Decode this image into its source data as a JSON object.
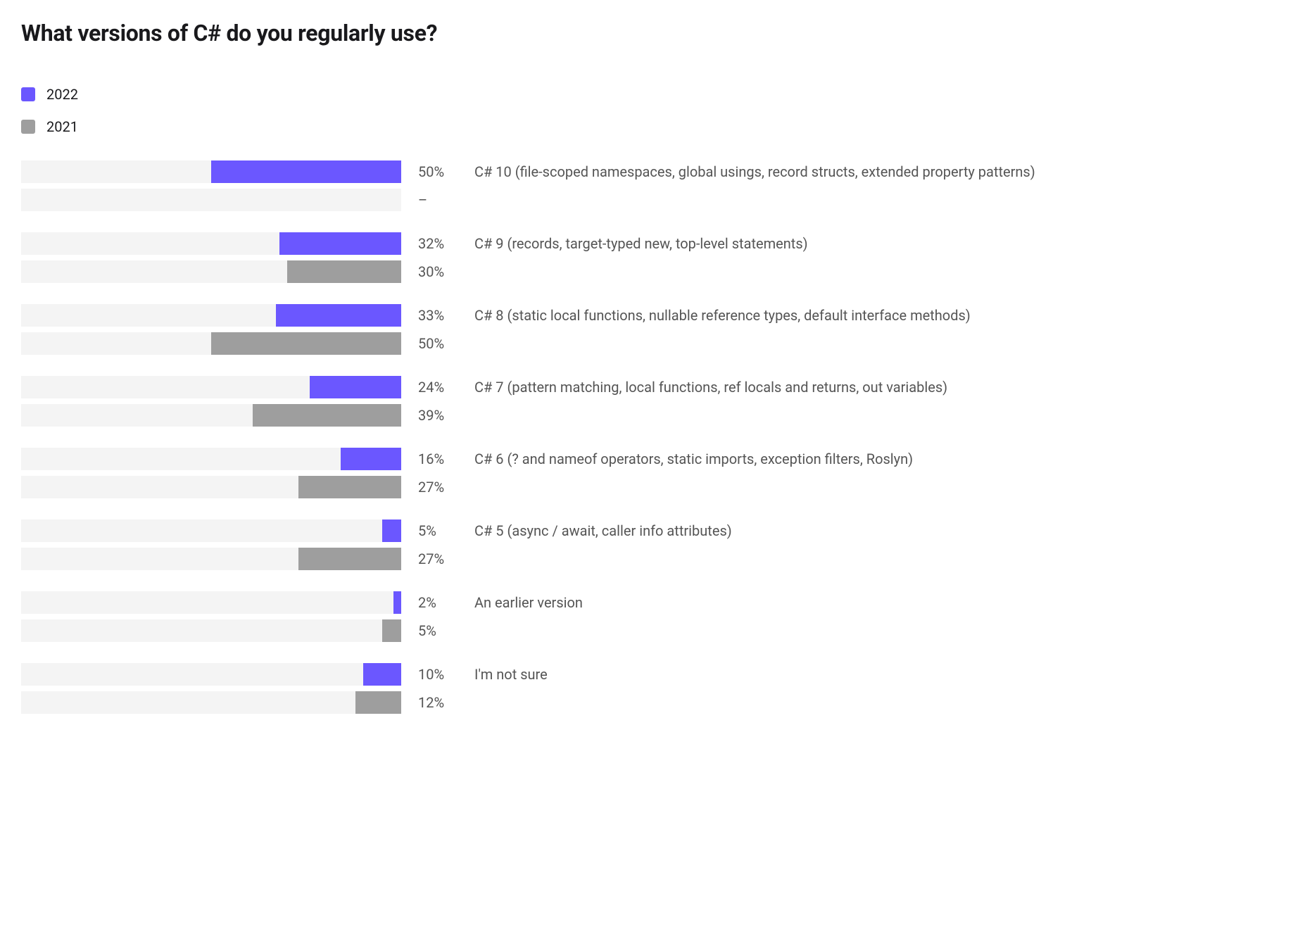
{
  "title": "What versions of C# do you regularly use?",
  "legend": [
    {
      "name": "2022",
      "color": "#6b57ff"
    },
    {
      "name": "2021",
      "color": "#9e9e9e"
    }
  ],
  "bar_track_width": 540,
  "chart_data": {
    "type": "bar",
    "orientation": "horizontal",
    "xlim": [
      0,
      100
    ],
    "unit": "%",
    "series": [
      {
        "name": "2022",
        "color": "#6b57ff"
      },
      {
        "name": "2021",
        "color": "#9e9e9e"
      }
    ],
    "categories": [
      "C# 10 (file-scoped namespaces, global usings, record structs, extended property patterns)",
      "C# 9 (records, target-typed new, top-level statements)",
      "C# 8 (static local functions, nullable reference types, default interface methods)",
      "C# 7 (pattern matching, local functions, ref locals and returns, out variables)",
      "C# 6 (? and nameof operators, static imports, exception filters, Roslyn)",
      "C# 5 (async / await, caller info attributes)",
      "An earlier version",
      "I'm not sure"
    ],
    "values": {
      "2022": [
        50,
        32,
        33,
        24,
        16,
        5,
        2,
        10
      ],
      "2021": [
        null,
        30,
        50,
        39,
        27,
        27,
        5,
        12
      ]
    }
  },
  "null_display": "–"
}
